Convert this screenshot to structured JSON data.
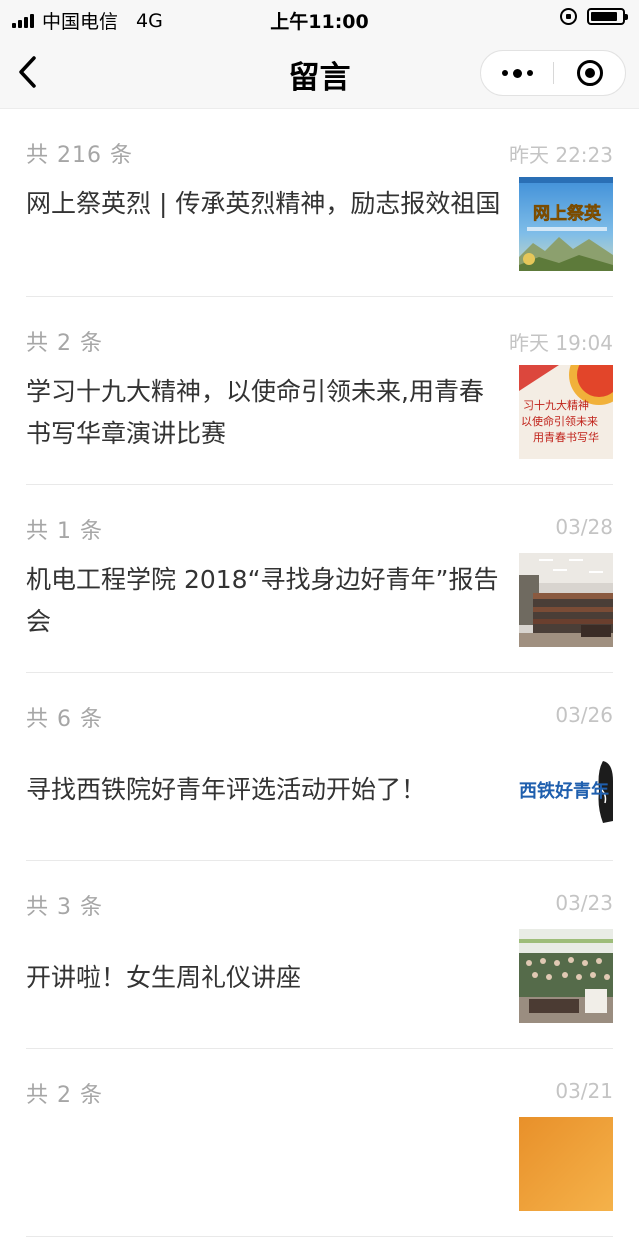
{
  "status_bar": {
    "carrier": "中国电信",
    "network": "4G",
    "time": "上午11:00"
  },
  "nav": {
    "title": "留言"
  },
  "items": [
    {
      "count": "共 216 条",
      "time": "昨天 22:23",
      "title": "网上祭英烈 | 传承英烈精神，励志报效祖国",
      "thumb_text": "网上祭英"
    },
    {
      "count": "共 2 条",
      "time": "昨天 19:04",
      "title": "学习十九大精神，以使命引领未来,用青春书写华章演讲比赛",
      "thumb_lines": [
        "习十九大精神",
        "以使命引领未来",
        "用青春书写华"
      ]
    },
    {
      "count": "共 1 条",
      "time": "03/28",
      "title": "机电工程学院 2018“寻找身边好青年”报告会"
    },
    {
      "count": "共 6 条",
      "time": "03/26",
      "title": "寻找西铁院好青年评选活动开始了！",
      "thumb_text": "西铁好青年"
    },
    {
      "count": "共 3 条",
      "time": "03/23",
      "title": "开讲啦！女生周礼仪讲座"
    },
    {
      "count": "共 2 条",
      "time": "03/21",
      "title": ""
    }
  ]
}
